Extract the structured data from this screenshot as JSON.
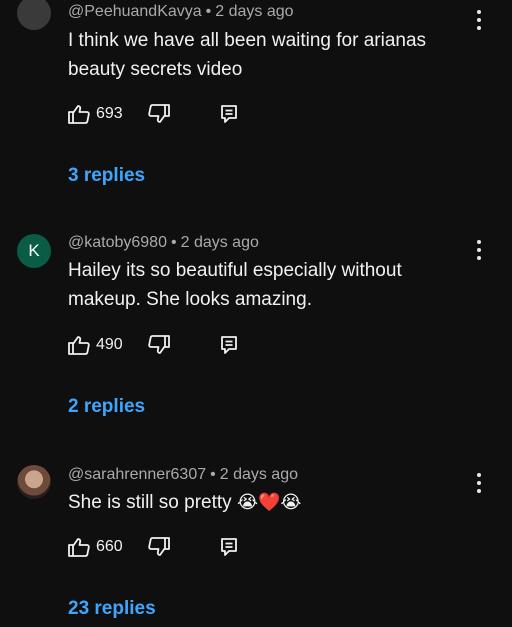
{
  "comments": [
    {
      "author": "@PeehuandKavya",
      "separator": "•",
      "time": "2 days ago",
      "text": "I think we have all been waiting for arianas beauty secrets video",
      "likes": "693",
      "replies": "3 replies",
      "avatar_letter": ""
    },
    {
      "author": "@katoby6980",
      "separator": "•",
      "time": "2 days ago",
      "text": "Hailey its so beautiful especially without makeup. She looks amazing.",
      "likes": "490",
      "replies": "2 replies",
      "avatar_letter": "K"
    },
    {
      "author": "@sarahrenner6307",
      "separator": "•",
      "time": "2 days ago",
      "text": "She is still so pretty ",
      "emojis": "😭❤️😭",
      "likes": "660",
      "replies": "23 replies",
      "avatar_letter": ""
    }
  ],
  "colors": {
    "background": "#0f0f0f",
    "link": "#3ea6ff",
    "meta": "#aaaaaa",
    "avatar_green": "#0b5c47"
  },
  "icons": [
    "thumbs-up-icon",
    "thumbs-down-icon",
    "reply-icon",
    "more-vert-icon"
  ]
}
